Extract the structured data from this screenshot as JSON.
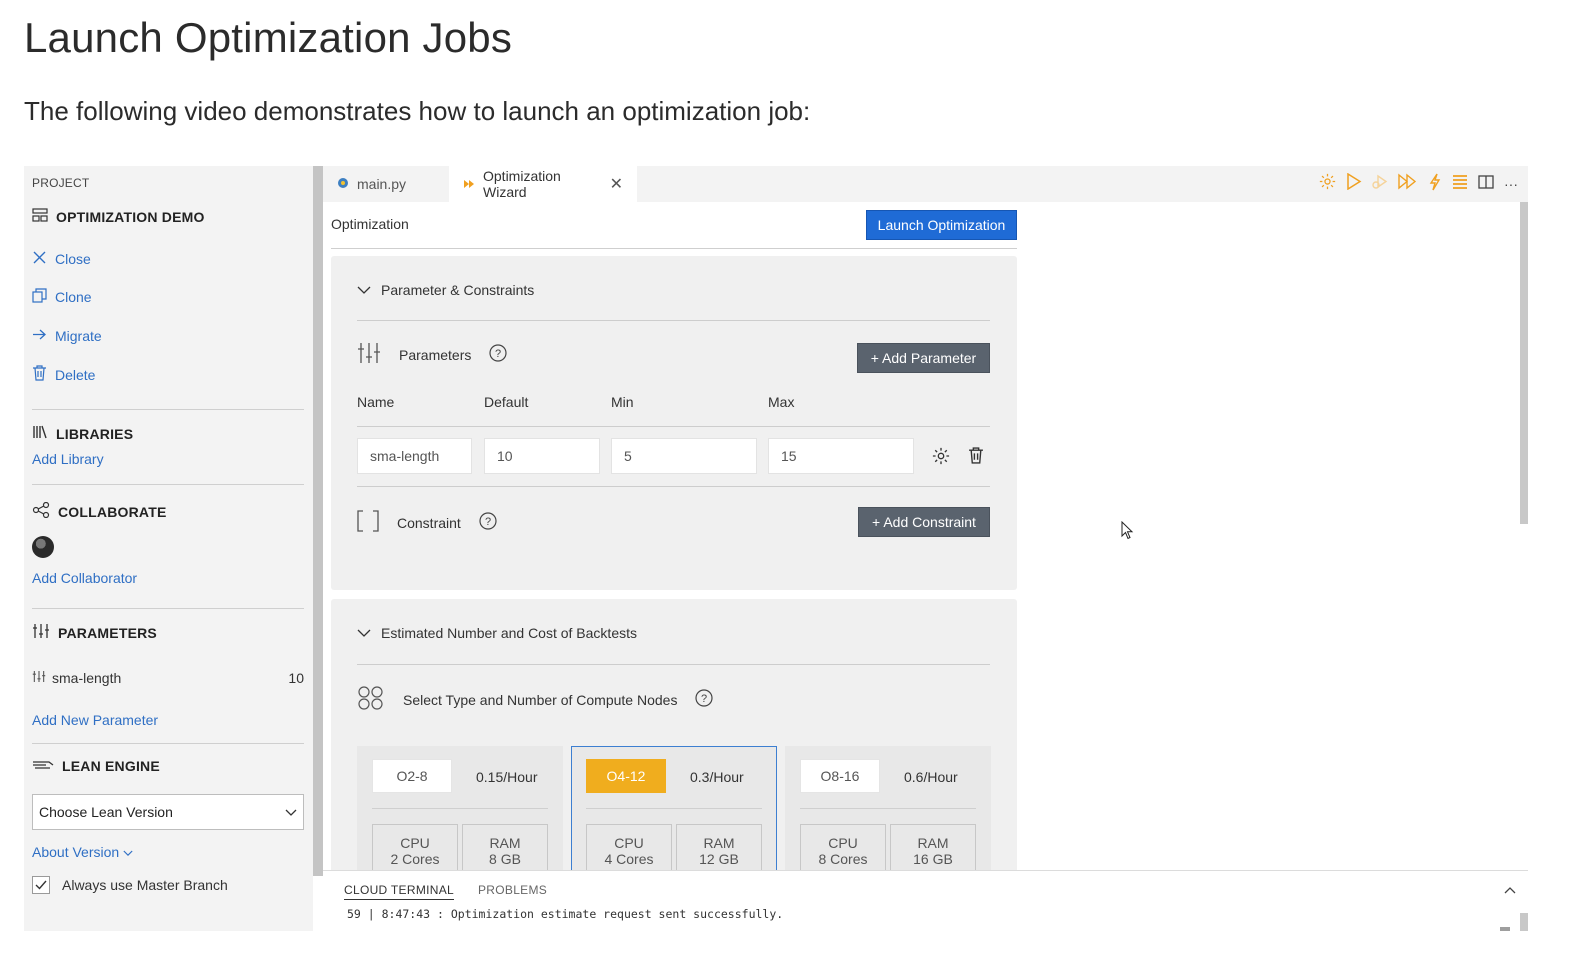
{
  "doc": {
    "title": "Launch Optimization Jobs",
    "intro": "The following video demonstrates how to launch an optimization job:"
  },
  "sidebar": {
    "project_label": "PROJECT",
    "project_name": "OPTIMIZATION DEMO",
    "actions": [
      {
        "label": "Close",
        "icon": "close-icon"
      },
      {
        "label": "Clone",
        "icon": "clone-icon"
      },
      {
        "label": "Migrate",
        "icon": "arrow-right-icon"
      },
      {
        "label": "Delete",
        "icon": "trash-icon"
      }
    ],
    "libraries": {
      "title": "LIBRARIES",
      "add": "Add Library"
    },
    "collaborate": {
      "title": "COLLABORATE",
      "add": "Add Collaborator"
    },
    "parameters": {
      "title": "PARAMETERS",
      "item_name": "sma-length",
      "item_value": "10",
      "add": "Add New Parameter"
    },
    "lean_engine": {
      "title": "LEAN ENGINE",
      "select_value": "Choose Lean Version",
      "about": "About Version",
      "checkbox_label": "Always use Master Branch",
      "checkbox_checked": true
    }
  },
  "tabs": [
    {
      "label": "main.py",
      "icon": "python-icon"
    },
    {
      "label": "Optimization Wizard",
      "icon": "optimization-icon"
    }
  ],
  "toolbar_icons": [
    "gear-icon",
    "play-icon",
    "debug-icon",
    "run-all-icon",
    "lightning-icon",
    "list-icon",
    "split-icon",
    "more-icon"
  ],
  "accent_color": "#f0ad1e",
  "primary_color": "#1f6bd6",
  "editor": {
    "header": "Optimization",
    "launch_button": "Launch Optimization",
    "param_section": {
      "title": "Parameter & Constraints",
      "parameters_label": "Parameters",
      "add_parameter": "+ Add Parameter",
      "columns": [
        "Name",
        "Default",
        "Min",
        "Max"
      ],
      "row": {
        "name": "sma-length",
        "default": "10",
        "min": "5",
        "max": "15"
      },
      "constraint_label": "Constraint",
      "add_constraint": "+ Add Constraint"
    },
    "cost_section": {
      "title": "Estimated Number and Cost of Backtests",
      "select_label": "Select Type and Number of Compute Nodes",
      "nodes": [
        {
          "name": "O2-8",
          "price": "0.15/Hour",
          "cpu_label": "CPU",
          "cpu": "2 Cores",
          "ram_label": "RAM",
          "ram": "8 GB",
          "selected": false
        },
        {
          "name": "O4-12",
          "price": "0.3/Hour",
          "cpu_label": "CPU",
          "cpu": "4 Cores",
          "ram_label": "RAM",
          "ram": "12 GB",
          "selected": true
        },
        {
          "name": "O8-16",
          "price": "0.6/Hour",
          "cpu_label": "CPU",
          "cpu": "8 Cores",
          "ram_label": "RAM",
          "ram": "16 GB",
          "selected": false
        }
      ]
    }
  },
  "terminal": {
    "tabs": [
      "CLOUD TERMINAL",
      "PROBLEMS"
    ],
    "line": "59 | 8:47:43  : Optimization estimate request sent successfully."
  }
}
